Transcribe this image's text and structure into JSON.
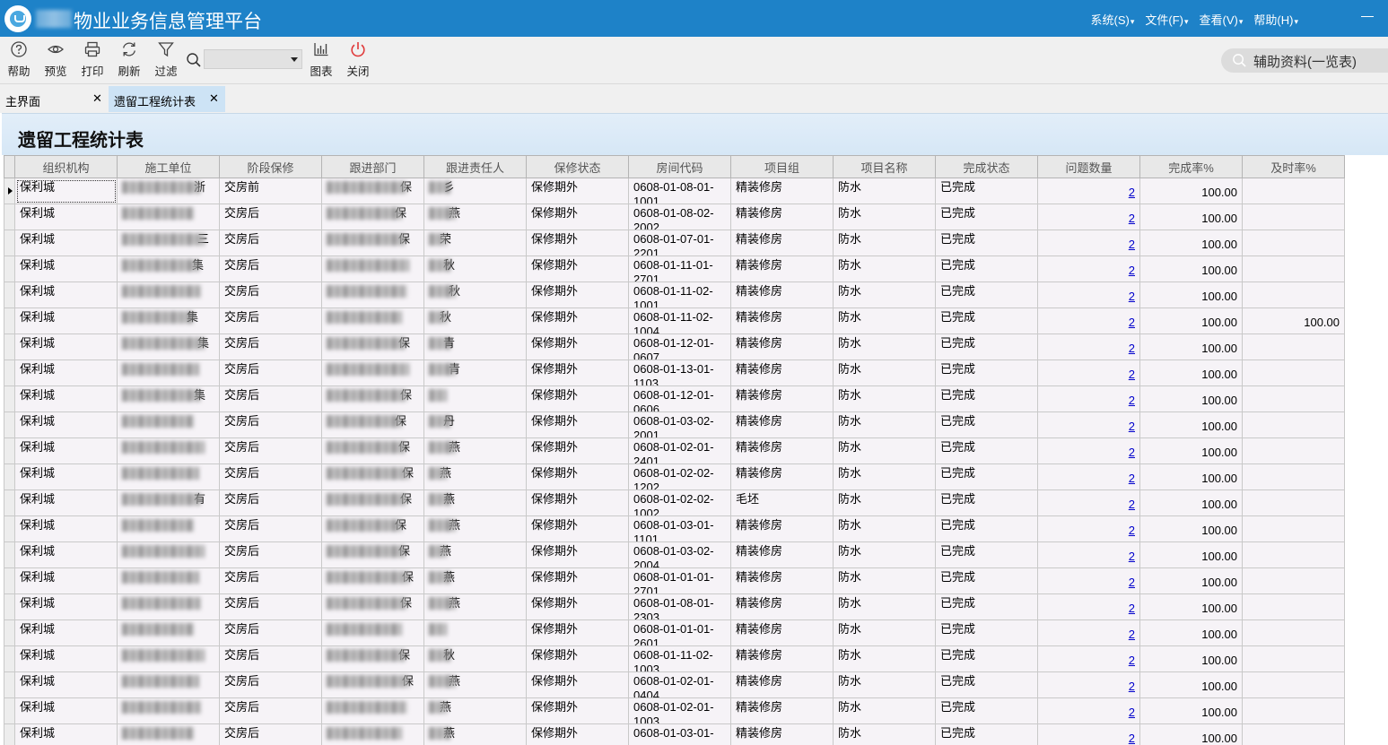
{
  "app": {
    "title": "物业业务信息管理平台",
    "menu": [
      "系统(S)",
      "文件(F)",
      "查看(V)",
      "帮助(H)"
    ]
  },
  "toolbar": {
    "help": "帮助",
    "preview": "预览",
    "print": "打印",
    "refresh": "刷新",
    "filter": "过滤",
    "chart": "图表",
    "close": "关闭",
    "search_value": "",
    "aux": "辅助资料(一览表)"
  },
  "tabs": [
    {
      "label": "主界面"
    },
    {
      "label": "遗留工程统计表"
    }
  ],
  "report": {
    "title": "遗留工程统计表",
    "columns": [
      "组织机构",
      "施工单位",
      "阶段保修",
      "跟进部门",
      "跟进责任人",
      "保修状态",
      "房间代码",
      "项目组",
      "项目名称",
      "完成状态",
      "问题数量",
      "完成率%",
      "及时率%"
    ],
    "rows": [
      {
        "org": "保利城",
        "contractor": "浙",
        "stage": "交房前",
        "dept": "保",
        "person": "彡",
        "warranty": "保修期外",
        "room": "0608-01-08-01-",
        "room2": "1001",
        "group": "精装修房",
        "project": "防水",
        "status": "已完成",
        "count": "2",
        "rate": "100.00",
        "timely": ""
      },
      {
        "org": "保利城",
        "contractor": "",
        "stage": "交房后",
        "dept": "保",
        "person": "燕",
        "warranty": "保修期外",
        "room": "0608-01-08-02-",
        "room2": "2002",
        "group": "精装修房",
        "project": "防水",
        "status": "已完成",
        "count": "2",
        "rate": "100.00",
        "timely": ""
      },
      {
        "org": "保利城",
        "contractor": "三",
        "stage": "交房后",
        "dept": "保",
        "person": "荣",
        "warranty": "保修期外",
        "room": "0608-01-07-01-",
        "room2": "2201",
        "group": "精装修房",
        "project": "防水",
        "status": "已完成",
        "count": "2",
        "rate": "100.00",
        "timely": ""
      },
      {
        "org": "保利城",
        "contractor": "集",
        "stage": "交房后",
        "dept": "",
        "person": "秋",
        "warranty": "保修期外",
        "room": "0608-01-11-01-",
        "room2": "2701",
        "group": "精装修房",
        "project": "防水",
        "status": "已完成",
        "count": "2",
        "rate": "100.00",
        "timely": ""
      },
      {
        "org": "保利城",
        "contractor": "",
        "stage": "交房后",
        "dept": "",
        "person": "秋",
        "warranty": "保修期外",
        "room": "0608-01-11-02-",
        "room2": "1001",
        "group": "精装修房",
        "project": "防水",
        "status": "已完成",
        "count": "2",
        "rate": "100.00",
        "timely": ""
      },
      {
        "org": "保利城",
        "contractor": "集",
        "stage": "交房后",
        "dept": "",
        "person": "秋",
        "warranty": "保修期外",
        "room": "0608-01-11-02-",
        "room2": "1004",
        "group": "精装修房",
        "project": "防水",
        "status": "已完成",
        "count": "2",
        "rate": "100.00",
        "timely": "100.00"
      },
      {
        "org": "保利城",
        "contractor": "集",
        "stage": "交房后",
        "dept": "保",
        "person": "青",
        "warranty": "保修期外",
        "room": "0608-01-12-01-",
        "room2": "0607",
        "group": "精装修房",
        "project": "防水",
        "status": "已完成",
        "count": "2",
        "rate": "100.00",
        "timely": ""
      },
      {
        "org": "保利城",
        "contractor": "",
        "stage": "交房后",
        "dept": "",
        "person": "青",
        "warranty": "保修期外",
        "room": "0608-01-13-01-",
        "room2": "1103",
        "group": "精装修房",
        "project": "防水",
        "status": "已完成",
        "count": "2",
        "rate": "100.00",
        "timely": ""
      },
      {
        "org": "保利城",
        "contractor": "集",
        "stage": "交房后",
        "dept": "保",
        "person": "",
        "warranty": "保修期外",
        "room": "0608-01-12-01-",
        "room2": "0606",
        "group": "精装修房",
        "project": "防水",
        "status": "已完成",
        "count": "2",
        "rate": "100.00",
        "timely": ""
      },
      {
        "org": "保利城",
        "contractor": "",
        "stage": "交房后",
        "dept": "保",
        "person": "丹",
        "warranty": "保修期外",
        "room": "0608-01-03-02-",
        "room2": "2001",
        "group": "精装修房",
        "project": "防水",
        "status": "已完成",
        "count": "2",
        "rate": "100.00",
        "timely": ""
      },
      {
        "org": "保利城",
        "contractor": "",
        "stage": "交房后",
        "dept": "保",
        "person": "燕",
        "warranty": "保修期外",
        "room": "0608-01-02-01-",
        "room2": "2401",
        "group": "精装修房",
        "project": "防水",
        "status": "已完成",
        "count": "2",
        "rate": "100.00",
        "timely": ""
      },
      {
        "org": "保利城",
        "contractor": "",
        "stage": "交房后",
        "dept": "保",
        "person": "燕",
        "warranty": "保修期外",
        "room": "0608-01-02-02-",
        "room2": "1202",
        "group": "精装修房",
        "project": "防水",
        "status": "已完成",
        "count": "2",
        "rate": "100.00",
        "timely": ""
      },
      {
        "org": "保利城",
        "contractor": "有",
        "stage": "交房后",
        "dept": "保",
        "person": "燕",
        "warranty": "保修期外",
        "room": "0608-01-02-02-",
        "room2": "1002",
        "group": "毛坯",
        "project": "防水",
        "status": "已完成",
        "count": "2",
        "rate": "100.00",
        "timely": ""
      },
      {
        "org": "保利城",
        "contractor": "",
        "stage": "交房后",
        "dept": "保",
        "person": "燕",
        "warranty": "保修期外",
        "room": "0608-01-03-01-",
        "room2": "1101",
        "group": "精装修房",
        "project": "防水",
        "status": "已完成",
        "count": "2",
        "rate": "100.00",
        "timely": ""
      },
      {
        "org": "保利城",
        "contractor": "",
        "stage": "交房后",
        "dept": "保",
        "person": "燕",
        "warranty": "保修期外",
        "room": "0608-01-03-02-",
        "room2": "2004",
        "group": "精装修房",
        "project": "防水",
        "status": "已完成",
        "count": "2",
        "rate": "100.00",
        "timely": ""
      },
      {
        "org": "保利城",
        "contractor": "",
        "stage": "交房后",
        "dept": "保",
        "person": "燕",
        "warranty": "保修期外",
        "room": "0608-01-01-01-",
        "room2": "2701",
        "group": "精装修房",
        "project": "防水",
        "status": "已完成",
        "count": "2",
        "rate": "100.00",
        "timely": ""
      },
      {
        "org": "保利城",
        "contractor": "",
        "stage": "交房后",
        "dept": "保",
        "person": "燕",
        "warranty": "保修期外",
        "room": "0608-01-08-01-",
        "room2": "2303",
        "group": "精装修房",
        "project": "防水",
        "status": "已完成",
        "count": "2",
        "rate": "100.00",
        "timely": ""
      },
      {
        "org": "保利城",
        "contractor": "",
        "stage": "交房后",
        "dept": "",
        "person": "",
        "warranty": "保修期外",
        "room": "0608-01-01-01-",
        "room2": "2601",
        "group": "精装修房",
        "project": "防水",
        "status": "已完成",
        "count": "2",
        "rate": "100.00",
        "timely": ""
      },
      {
        "org": "保利城",
        "contractor": "",
        "stage": "交房后",
        "dept": "保",
        "person": "秋",
        "warranty": "保修期外",
        "room": "0608-01-11-02-",
        "room2": "1003",
        "group": "精装修房",
        "project": "防水",
        "status": "已完成",
        "count": "2",
        "rate": "100.00",
        "timely": ""
      },
      {
        "org": "保利城",
        "contractor": "",
        "stage": "交房后",
        "dept": "保",
        "person": "燕",
        "warranty": "保修期外",
        "room": "0608-01-02-01-",
        "room2": "0404",
        "group": "精装修房",
        "project": "防水",
        "status": "已完成",
        "count": "2",
        "rate": "100.00",
        "timely": ""
      },
      {
        "org": "保利城",
        "contractor": "",
        "stage": "交房后",
        "dept": "",
        "person": "燕",
        "warranty": "保修期外",
        "room": "0608-01-02-01-",
        "room2": "1003",
        "group": "精装修房",
        "project": "防水",
        "status": "已完成",
        "count": "2",
        "rate": "100.00",
        "timely": ""
      },
      {
        "org": "保利城",
        "contractor": "",
        "stage": "交房后",
        "dept": "",
        "person": "燕",
        "warranty": "保修期外",
        "room": "0608-01-03-01-",
        "room2": "",
        "group": "精装修房",
        "project": "防水",
        "status": "已完成",
        "count": "2",
        "rate": "100.00",
        "timely": ""
      }
    ]
  }
}
